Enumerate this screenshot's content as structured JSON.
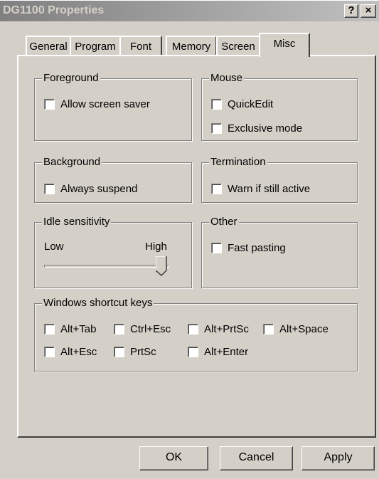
{
  "window": {
    "title": "DG1100 Properties",
    "help_button": "?",
    "close_button": "×"
  },
  "tabs": [
    {
      "label": "General"
    },
    {
      "label": "Program"
    },
    {
      "label": "Font"
    },
    {
      "label": "Memory"
    },
    {
      "label": "Screen"
    },
    {
      "label": "Misc",
      "active": true
    }
  ],
  "groups": {
    "foreground": {
      "label": "Foreground",
      "allow_screen_saver": {
        "label": "Allow screen saver",
        "checked": false
      }
    },
    "mouse": {
      "label": "Mouse",
      "quickedit": {
        "label": "QuickEdit",
        "checked": false
      },
      "exclusive_mode": {
        "label": "Exclusive mode",
        "checked": false
      }
    },
    "background": {
      "label": "Background",
      "always_suspend": {
        "label": "Always suspend",
        "checked": false
      }
    },
    "termination": {
      "label": "Termination",
      "warn_if_active": {
        "label": "Warn if still active",
        "checked": false
      }
    },
    "idle": {
      "label": "Idle sensitivity",
      "low_label": "Low",
      "high_label": "High",
      "level": 1.0
    },
    "other": {
      "label": "Other",
      "fast_pasting": {
        "label": "Fast pasting",
        "checked": false
      }
    },
    "shortcuts": {
      "label": "Windows shortcut keys",
      "items": [
        {
          "label": "Alt+Tab",
          "checked": false
        },
        {
          "label": "Ctrl+Esc",
          "checked": false
        },
        {
          "label": "Alt+PrtSc",
          "checked": false
        },
        {
          "label": "Alt+Space",
          "checked": false
        },
        {
          "label": "Alt+Esc",
          "checked": false
        },
        {
          "label": "PrtSc",
          "checked": false
        },
        {
          "label": "Alt+Enter",
          "checked": false
        }
      ]
    }
  },
  "buttons": {
    "ok": "OK",
    "cancel": "Cancel",
    "apply": "Apply"
  }
}
